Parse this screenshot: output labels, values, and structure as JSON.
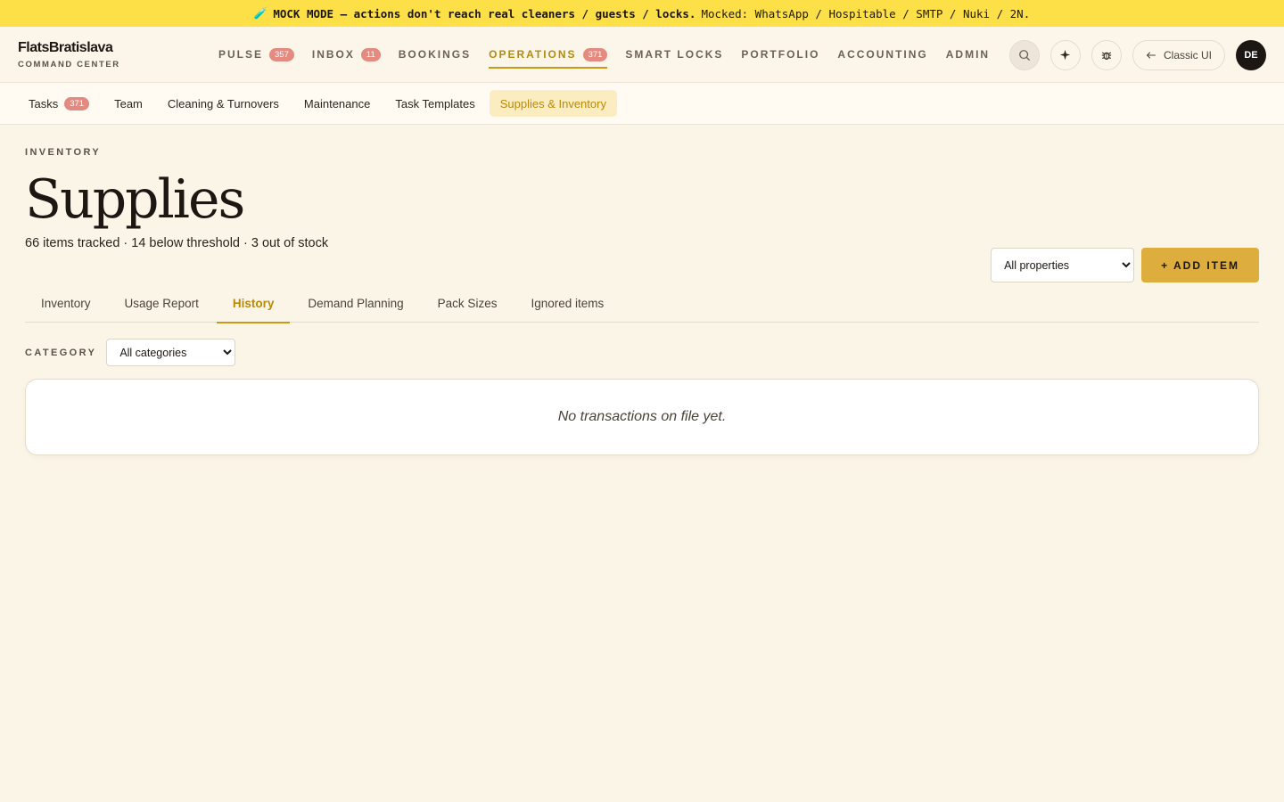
{
  "banner": {
    "icon": "🧪",
    "strong": "MOCK MODE — actions don't reach real cleaners / guests / locks.",
    "rest": "Mocked: WhatsApp / Hospitable / SMTP / Nuki / 2N."
  },
  "brand": {
    "name": "FlatsBratislava",
    "sub": "COMMAND CENTER"
  },
  "nav": [
    {
      "label": "PULSE",
      "badge": "357"
    },
    {
      "label": "INBOX",
      "badge": "11"
    },
    {
      "label": "BOOKINGS"
    },
    {
      "label": "OPERATIONS",
      "badge": "371",
      "active": true
    },
    {
      "label": "SMART LOCKS"
    },
    {
      "label": "PORTFOLIO"
    },
    {
      "label": "ACCOUNTING"
    },
    {
      "label": "ADMIN"
    }
  ],
  "top_right": {
    "icons": [
      "search-icon",
      "sparkle-icon",
      "bug-icon"
    ],
    "classic_label": "Classic UI",
    "avatar": "DE"
  },
  "subnav": [
    {
      "label": "Tasks",
      "badge": "371"
    },
    {
      "label": "Team"
    },
    {
      "label": "Cleaning & Turnovers"
    },
    {
      "label": "Maintenance"
    },
    {
      "label": "Task Templates"
    },
    {
      "label": "Supplies & Inventory",
      "active": true
    }
  ],
  "page": {
    "eyebrow": "INVENTORY",
    "title": "Supplies",
    "subtitle": "66 items tracked · 14 below threshold · 3 out of stock",
    "property_select": "All properties",
    "add_button": "+ ADD ITEM"
  },
  "tabs": [
    {
      "label": "Inventory"
    },
    {
      "label": "Usage Report"
    },
    {
      "label": "History",
      "active": true
    },
    {
      "label": "Demand Planning"
    },
    {
      "label": "Pack Sizes"
    },
    {
      "label": "Ignored items"
    }
  ],
  "filter": {
    "label": "CATEGORY",
    "value": "All categories"
  },
  "empty": {
    "text": "No transactions on file yet."
  },
  "colors": {
    "accent": "#c99a18",
    "banner": "#fde047",
    "badge": "#e48a80",
    "button": "#ddae3e"
  }
}
